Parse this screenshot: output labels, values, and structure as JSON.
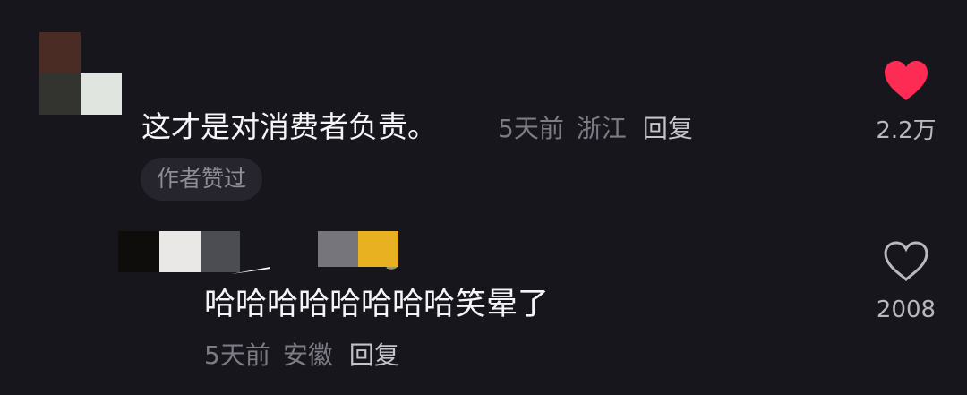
{
  "comments": [
    {
      "text": "这才是对消费者负责。",
      "time": "5天前",
      "location": "浙江",
      "reply_label": "回复",
      "badge": "作者赞过",
      "likes": "2.2万",
      "liked": true,
      "like_color": "#fe2c55"
    },
    {
      "text": "哈哈哈哈哈哈哈哈笑晕了",
      "time": "5天前",
      "location": "安徽",
      "reply_label": "回复",
      "likes": "2008",
      "liked": false
    }
  ],
  "colors": {
    "background": "#17161d",
    "meta_text": "#7d7c85",
    "badge_bg": "#26252d"
  }
}
